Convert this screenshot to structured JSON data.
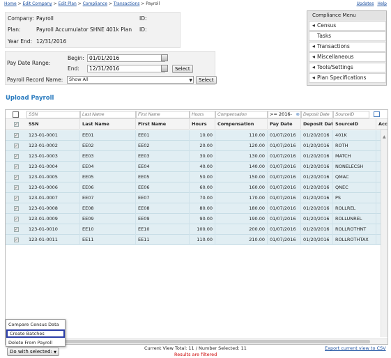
{
  "breadcrumbs": [
    "Home",
    "Edit Company",
    "Edit Plan",
    "Compliance",
    "Transactions"
  ],
  "breadcrumb_sep": ">",
  "breadcrumb_current": "Payroll",
  "top_links": {
    "updates": "Updates",
    "help": "Help"
  },
  "info": {
    "company_label": "Company:",
    "company": "Payroll",
    "company_id_label": "ID:",
    "plan_label": "Plan:",
    "plan": "Payroll Accumulator SHNE 401k Plan",
    "plan_id_label": "ID:",
    "year_end_label": "Year End:",
    "year_end": "12/31/2016"
  },
  "filters": {
    "pay_date_range_label": "Pay Date Range:",
    "begin_label": "Begin:",
    "begin_value": "01/01/2016",
    "end_label": "End:",
    "end_value": "12/31/2016",
    "select_label": "Select",
    "record_name_label": "Payroll Record Name:",
    "record_name_value": "Show All"
  },
  "compliance_menu": {
    "title": "Compliance Menu",
    "items": [
      {
        "label": "Census",
        "arrow": true
      },
      {
        "label": "Tasks",
        "arrow": false
      },
      {
        "label": "Transactions",
        "arrow": true
      },
      {
        "label": "Miscellaneous",
        "arrow": true
      },
      {
        "label": "Tools/Settings",
        "arrow": true
      },
      {
        "label": "Plan Specifications",
        "arrow": true
      }
    ]
  },
  "section_title": "Upload Payroll",
  "grid": {
    "filter_placeholders": [
      "SSN",
      "Last Name",
      "First Name",
      "Hours",
      "Compensation",
      ">= 2016-",
      "Deposit Date",
      "SourceID"
    ],
    "columns": [
      "SSN",
      "Last Name",
      "First Name",
      "Hours",
      "Compensation",
      "Pay Date",
      "Deposit Date",
      "SourceID",
      "Acc"
    ],
    "rows": [
      [
        "123-01-0001",
        "EE01",
        "EE01",
        "10.00",
        "110.00",
        "01/07/2016",
        "01/20/2016",
        "401K"
      ],
      [
        "123-01-0002",
        "EE02",
        "EE02",
        "20.00",
        "120.00",
        "01/07/2016",
        "01/20/2016",
        "ROTH"
      ],
      [
        "123-01-0003",
        "EE03",
        "EE03",
        "30.00",
        "130.00",
        "01/07/2016",
        "01/20/2016",
        "MATCH"
      ],
      [
        "123-01-0004",
        "EE04",
        "EE04",
        "40.00",
        "140.00",
        "01/07/2016",
        "01/20/2016",
        "NONELECSH"
      ],
      [
        "123-01-0005",
        "EE05",
        "EE05",
        "50.00",
        "150.00",
        "01/07/2016",
        "01/20/2016",
        "QMAC"
      ],
      [
        "123-01-0006",
        "EE06",
        "EE06",
        "60.00",
        "160.00",
        "01/07/2016",
        "01/20/2016",
        "QNEC"
      ],
      [
        "123-01-0007",
        "EE07",
        "EE07",
        "70.00",
        "170.00",
        "01/07/2016",
        "01/20/2016",
        "PS"
      ],
      [
        "123-01-0008",
        "EE08",
        "EE08",
        "80.00",
        "180.00",
        "01/07/2016",
        "01/20/2016",
        "ROLLREL"
      ],
      [
        "123-01-0009",
        "EE09",
        "EE09",
        "90.00",
        "190.00",
        "01/07/2016",
        "01/20/2016",
        "ROLLUNREL"
      ],
      [
        "123-01-0010",
        "EE10",
        "EE10",
        "100.00",
        "200.00",
        "01/07/2016",
        "01/20/2016",
        "ROLLROTHNT"
      ],
      [
        "123-01-0011",
        "EE11",
        "EE11",
        "110.00",
        "210.00",
        "01/07/2016",
        "01/20/2016",
        "ROLLROTHTAX"
      ]
    ]
  },
  "action_menu": {
    "items": [
      "Compare Census Data",
      "Create Batches",
      "Delete From Payroll"
    ],
    "highlighted": "Create Batches",
    "button_label": "Do with selected:"
  },
  "footer": {
    "status": "Current View Total: 11 / Number Selected: 11",
    "filtered": "Results are filtered",
    "export": "Export current view to CSV"
  },
  "colors": {
    "accent": "#2a7bbf",
    "row_bg": "#e1eef3",
    "highlight_border": "#2b3ea8",
    "filtered_text": "#cc0000"
  }
}
